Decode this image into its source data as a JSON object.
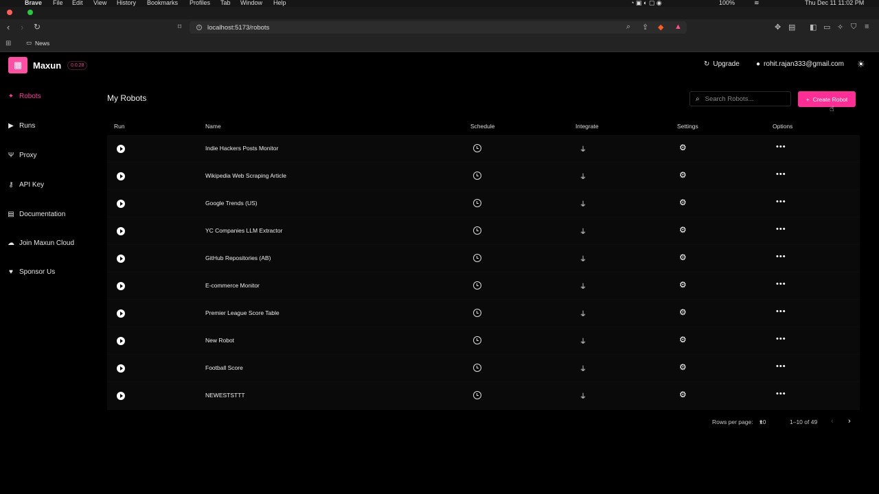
{
  "menubar": {
    "app": "Brave",
    "items": [
      "File",
      "Edit",
      "View",
      "History",
      "Bookmarks",
      "Profiles",
      "Tab",
      "Window",
      "Help"
    ],
    "battery": "100%",
    "datetime": "Thu Dec 11  11:02 PM"
  },
  "browser": {
    "url": "localhost:5173/robots",
    "bookmark_folder": "News"
  },
  "app": {
    "brand": "Maxun",
    "version": "0.0.28",
    "upgrade_label": "Upgrade",
    "user_email": "rohit.rajan333@gmail.com",
    "accent": "#ff2e95"
  },
  "sidebar": {
    "items": [
      {
        "label": "Robots",
        "icon": "sparkle-icon",
        "active": true
      },
      {
        "label": "Runs",
        "icon": "play-icon"
      },
      {
        "label": "Proxy",
        "icon": "usb-icon"
      },
      {
        "label": "API Key",
        "icon": "key-icon"
      },
      {
        "label": "Documentation",
        "icon": "document-icon"
      },
      {
        "label": "Join Maxun Cloud",
        "icon": "cloud-icon"
      },
      {
        "label": "Sponsor Us",
        "icon": "heart-icon"
      }
    ]
  },
  "main": {
    "title": "My Robots",
    "search_placeholder": "Search Robots...",
    "create_label": "Create Robot",
    "columns": [
      "Run",
      "Name",
      "Schedule",
      "Integrate",
      "Settings",
      "Options"
    ],
    "robots": [
      "Indie Hackers Posts Monitor",
      "Wikipedia Web Scraping Article",
      "Google Trends (US)",
      "YC Companies LLM Extractor",
      "GitHub Repositories (AB)",
      "E-commerce Monitor",
      "Premier League Score Table",
      "New Robot",
      "Football Score",
      "NEWESTSTTT"
    ],
    "pagination": {
      "rows_per_page_label": "Rows per page:",
      "rows_per_page": "10",
      "range": "1–10 of 49"
    }
  }
}
